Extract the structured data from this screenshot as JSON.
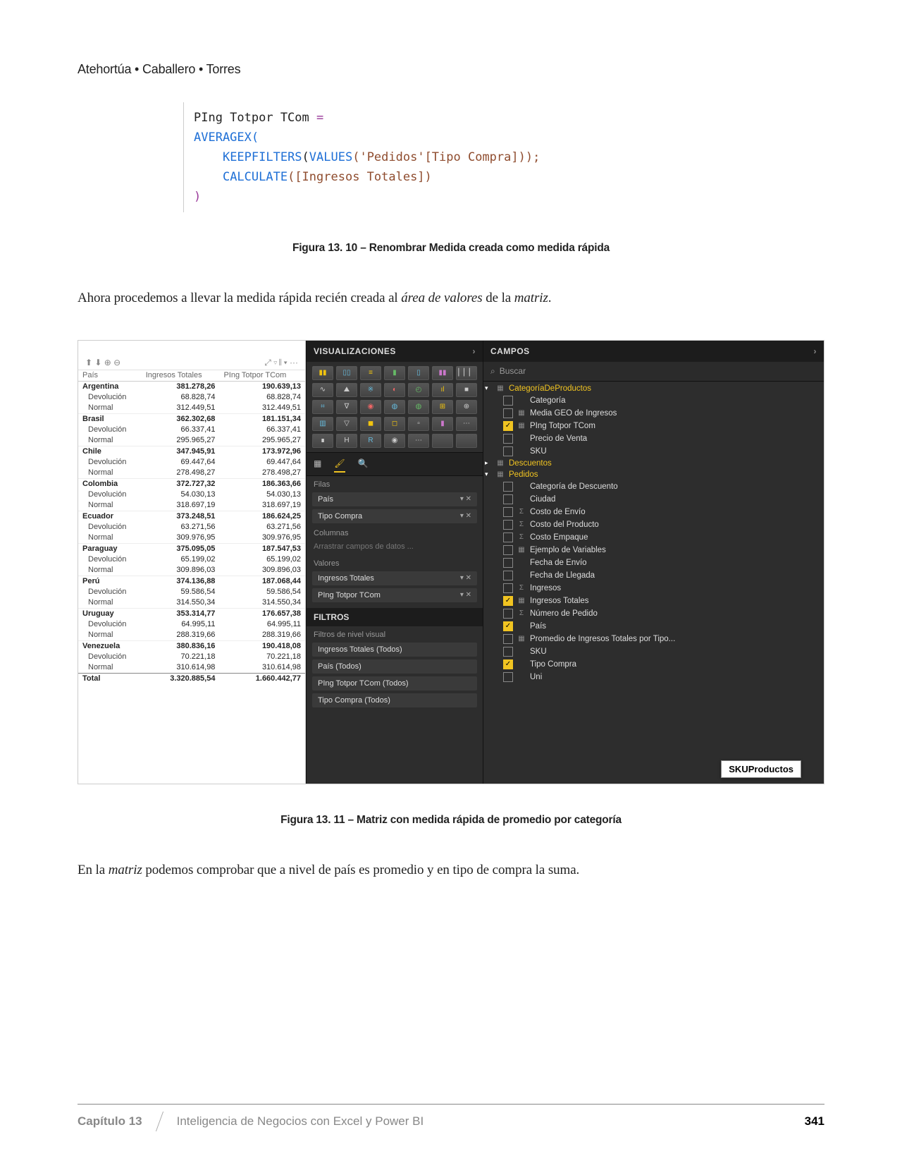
{
  "authors": "Atehortúa • Caballero • Torres",
  "code": {
    "l1_a": "PIng Totpor TCom ",
    "l1_b": "=",
    "l2": "AVERAGEX(",
    "l3a": "    ",
    "l3b": "KEEPFILTERS",
    "l3c": "(",
    "l3d": "VALUES",
    "l3e": "('Pedidos'[Tipo Compra]));",
    "l4a": "    ",
    "l4b": "CALCULATE",
    "l4c": "([Ingresos Totales])",
    "l5": ")"
  },
  "caption1": "Figura 13. 10 – Renombrar Medida creada como medida rápida",
  "para1": {
    "pre": "Ahora procedemos a llevar la medida rápida recién creada al ",
    "em1": "área de valores",
    "mid": " de la ",
    "em2": "matriz",
    "end": "."
  },
  "caption2": "Figura 13. 11 – Matriz con medida rápida de promedio por categoría",
  "para2": {
    "pre": "En la ",
    "em1": "matriz",
    "end": " podemos comprobar que a nivel de país es promedio y en tipo de compra la suma."
  },
  "matrix": {
    "col_pais": "País",
    "col_ing": "Ingresos Totales",
    "col_ping": "PIng Totpor TCom",
    "rows": [
      {
        "t": "c",
        "p": "Argentina",
        "a": "381.278,26",
        "b": "190.639,13"
      },
      {
        "t": "s",
        "p": "Devolución",
        "a": "68.828,74",
        "b": "68.828,74"
      },
      {
        "t": "s",
        "p": "Normal",
        "a": "312.449,51",
        "b": "312.449,51"
      },
      {
        "t": "c",
        "p": "Brasil",
        "a": "362.302,68",
        "b": "181.151,34"
      },
      {
        "t": "s",
        "p": "Devolución",
        "a": "66.337,41",
        "b": "66.337,41"
      },
      {
        "t": "s",
        "p": "Normal",
        "a": "295.965,27",
        "b": "295.965,27"
      },
      {
        "t": "c",
        "p": "Chile",
        "a": "347.945,91",
        "b": "173.972,96"
      },
      {
        "t": "s",
        "p": "Devolución",
        "a": "69.447,64",
        "b": "69.447,64"
      },
      {
        "t": "s",
        "p": "Normal",
        "a": "278.498,27",
        "b": "278.498,27"
      },
      {
        "t": "c",
        "p": "Colombia",
        "a": "372.727,32",
        "b": "186.363,66"
      },
      {
        "t": "s",
        "p": "Devolución",
        "a": "54.030,13",
        "b": "54.030,13"
      },
      {
        "t": "s",
        "p": "Normal",
        "a": "318.697,19",
        "b": "318.697,19"
      },
      {
        "t": "c",
        "p": "Ecuador",
        "a": "373.248,51",
        "b": "186.624,25"
      },
      {
        "t": "s",
        "p": "Devolución",
        "a": "63.271,56",
        "b": "63.271,56"
      },
      {
        "t": "s",
        "p": "Normal",
        "a": "309.976,95",
        "b": "309.976,95"
      },
      {
        "t": "c",
        "p": "Paraguay",
        "a": "375.095,05",
        "b": "187.547,53"
      },
      {
        "t": "s",
        "p": "Devolución",
        "a": "65.199,02",
        "b": "65.199,02"
      },
      {
        "t": "s",
        "p": "Normal",
        "a": "309.896,03",
        "b": "309.896,03"
      },
      {
        "t": "c",
        "p": "Perú",
        "a": "374.136,88",
        "b": "187.068,44"
      },
      {
        "t": "s",
        "p": "Devolución",
        "a": "59.586,54",
        "b": "59.586,54"
      },
      {
        "t": "s",
        "p": "Normal",
        "a": "314.550,34",
        "b": "314.550,34"
      },
      {
        "t": "c",
        "p": "Uruguay",
        "a": "353.314,77",
        "b": "176.657,38"
      },
      {
        "t": "s",
        "p": "Devolución",
        "a": "64.995,11",
        "b": "64.995,11"
      },
      {
        "t": "s",
        "p": "Normal",
        "a": "288.319,66",
        "b": "288.319,66"
      },
      {
        "t": "c",
        "p": "Venezuela",
        "a": "380.836,16",
        "b": "190.418,08"
      },
      {
        "t": "s",
        "p": "Devolución",
        "a": "70.221,18",
        "b": "70.221,18"
      },
      {
        "t": "s",
        "p": "Normal",
        "a": "310.614,98",
        "b": "310.614,98"
      }
    ],
    "total_label": "Total",
    "total_a": "3.320.885,54",
    "total_b": "1.660.442,77"
  },
  "viz": {
    "title": "VISUALIZACIONES",
    "filas": "Filas",
    "col_label": "Columnas",
    "col_ph": "Arrastrar campos de datos ...",
    "val_label": "Valores",
    "well_pais": "País",
    "well_tipo": "Tipo Compra",
    "well_ing": "Ingresos Totales",
    "well_ping": "PIng Totpor TCom",
    "filters_title": "FILTROS",
    "filt_level": "Filtros de nivel visual",
    "filt_ing": "Ingresos Totales (Todos)",
    "filt_pais": "País (Todos)",
    "filt_ping": "PIng Totpor TCom (Todos)",
    "filt_tipo": "Tipo Compra (Todos)"
  },
  "campos": {
    "title": "CAMPOS",
    "search": "Buscar",
    "g1": "CategoríaDeProductos",
    "g1_fields": [
      {
        "n": "Categoría",
        "chk": false
      },
      {
        "n": "Media GEO de Ingresos",
        "chk": false,
        "ico": "▦"
      },
      {
        "n": "PIng Totpor TCom",
        "chk": true,
        "ico": "▦"
      },
      {
        "n": "Precio de Venta",
        "chk": false
      },
      {
        "n": "SKU",
        "chk": false
      }
    ],
    "g2": "Descuentos",
    "g3": "Pedidos",
    "g3_fields": [
      {
        "n": "Categoría de Descuento",
        "chk": false
      },
      {
        "n": "Ciudad",
        "chk": false
      },
      {
        "n": "Costo de Envío",
        "chk": false,
        "ico": "Σ"
      },
      {
        "n": "Costo del Producto",
        "chk": false,
        "ico": "Σ"
      },
      {
        "n": "Costo Empaque",
        "chk": false,
        "ico": "Σ"
      },
      {
        "n": "Ejemplo de Variables",
        "chk": false,
        "ico": "▦"
      },
      {
        "n": "Fecha de Envío",
        "chk": false
      },
      {
        "n": "Fecha de Llegada",
        "chk": false
      },
      {
        "n": "Ingresos",
        "chk": false,
        "ico": "Σ"
      },
      {
        "n": "Ingresos Totales",
        "chk": true,
        "ico": "▦"
      },
      {
        "n": "Número de Pedido",
        "chk": false,
        "ico": "Σ"
      },
      {
        "n": "País",
        "chk": true
      },
      {
        "n": "Promedio de Ingresos Totales por Tipo...",
        "chk": false,
        "ico": "▦"
      },
      {
        "n": "SKU",
        "chk": false
      },
      {
        "n": "Tipo Compra",
        "chk": true
      },
      {
        "n": "Uni",
        "chk": false
      }
    ],
    "tooltip": "SKUProductos"
  },
  "footer": {
    "chapter": "Capítulo 13",
    "title": "Inteligencia de Negocios con Excel y Power BI",
    "page": "341"
  }
}
